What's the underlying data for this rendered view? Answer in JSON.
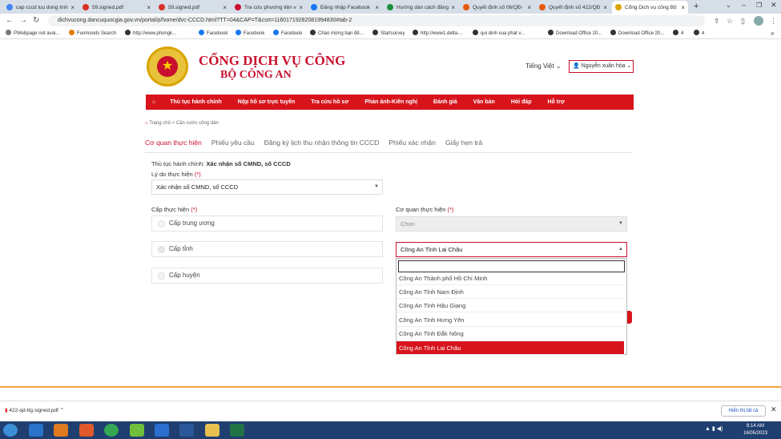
{
  "browser": {
    "tabs": [
      {
        "title": "cap cccd luu dong tinh",
        "color": "#4285f4"
      },
      {
        "title": "59.signed.pdf",
        "color": "#d93025"
      },
      {
        "title": "59.signed.pdf",
        "color": "#d93025"
      },
      {
        "title": "Tra cứu phương tiện vi",
        "color": "#c8102e"
      },
      {
        "title": "Đăng nhập Facebook",
        "color": "#1877f2"
      },
      {
        "title": "Hướng dẫn cách đăng",
        "color": "#1e8e3e"
      },
      {
        "title": "Quyết định số 06/QĐ-",
        "color": "#e8590c"
      },
      {
        "title": "Quyết định số 422/QĐ",
        "color": "#e8590c"
      },
      {
        "title": "Cổng Dịch vụ công Bộ",
        "color": "#d9a400"
      }
    ],
    "url": "dichvucong.dancuquocgia.gov.vn/portal/p/home/dvc-CCCD.html?TT=04&CAP=T&csrt=11601719282081994830#tab-2",
    "bookmarks": [
      "PWebpage not avai...",
      "Funmoods Search",
      "http://www.phongk...",
      "Facebook",
      "Facebook",
      "Facebook",
      "Chào mừng bạn đế...",
      "Startsurvey",
      "http://www1.delta-...",
      "qui dinh xua phat v...",
      "Download Office 20...",
      "Download Office 20...",
      "4",
      "4"
    ]
  },
  "header": {
    "brand_line1": "CỔNG DỊCH VỤ CÔNG",
    "brand_line2": "BỘ CÔNG AN",
    "language": "Tiếng Việt",
    "user": "Nguyễn xuân hòa"
  },
  "menu": [
    "Thủ tục hành chính",
    "Nộp hồ sơ trực tuyến",
    "Tra cứu hồ sơ",
    "Phản ánh-Kiến nghị",
    "Đánh giá",
    "Văn bản",
    "Hỏi đáp",
    "Hỗ trợ"
  ],
  "breadcrumb": {
    "home": "Trang chủ",
    "current": "Căn cước công dân"
  },
  "subtabs": [
    "Cơ quan thực hiện",
    "Phiếu yêu cầu",
    "Đăng ký lịch thu nhận thông tin CCCD",
    "Phiếu xác nhận",
    "Giấy hẹn trả"
  ],
  "form": {
    "procedure_label": "Thủ tục hành chính:",
    "procedure_value": "Xác nhận số CMND, số CCCD",
    "reason_label": "Lý do thực hiện",
    "reason_value": "Xác nhận số CMND, số CCCD",
    "level_label": "Cấp thực hiện",
    "levels": [
      "Cấp trung ương",
      "Cấp tỉnh",
      "Cấp huyện"
    ],
    "agency_label": "Cơ quan thực hiện",
    "agency_placeholder": "Chọn",
    "agency_value": "Công An Tỉnh Lai Châu",
    "required": "(*)"
  },
  "dropdown_options": [
    "Công An Thành phố Hồ Chí Minh",
    "Công An Tỉnh Nam Định",
    "Công An Tỉnh Hậu Giang",
    "Công An Tỉnh Hưng Yên",
    "Công An Tỉnh Đắk Nông",
    "Công An Tỉnh Lai Châu"
  ],
  "downloads": {
    "file": "422-qd-ttg.signed.pdf",
    "show_all": "Hiển thị tất cả"
  },
  "taskbar": {
    "time": "8:14 AM",
    "date": "16/05/2023"
  }
}
